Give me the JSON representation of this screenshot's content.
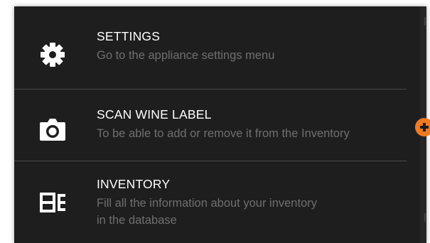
{
  "menu": {
    "items": [
      {
        "title": "SETTINGS",
        "desc_lines": [
          "Go to the appliance settings menu"
        ],
        "icon": "gear-icon"
      },
      {
        "title": "SCAN WINE LABEL",
        "desc_lines": [
          "To be able to add or remove it from the Inventory"
        ],
        "icon": "camera-icon"
      },
      {
        "title": "INVENTORY",
        "desc_lines": [
          "Fill all the information about your inventory",
          "in the database"
        ],
        "icon": "inventory-rack-icon"
      }
    ]
  },
  "fab": {
    "icon": "plus-icon",
    "color": "#f07a22"
  },
  "colors": {
    "panel_bg": "#1e1e1e",
    "title_text": "#ffffff",
    "desc_text": "#6f6f6f",
    "divider": "#4a4a4a",
    "accent": "#f07a22"
  }
}
